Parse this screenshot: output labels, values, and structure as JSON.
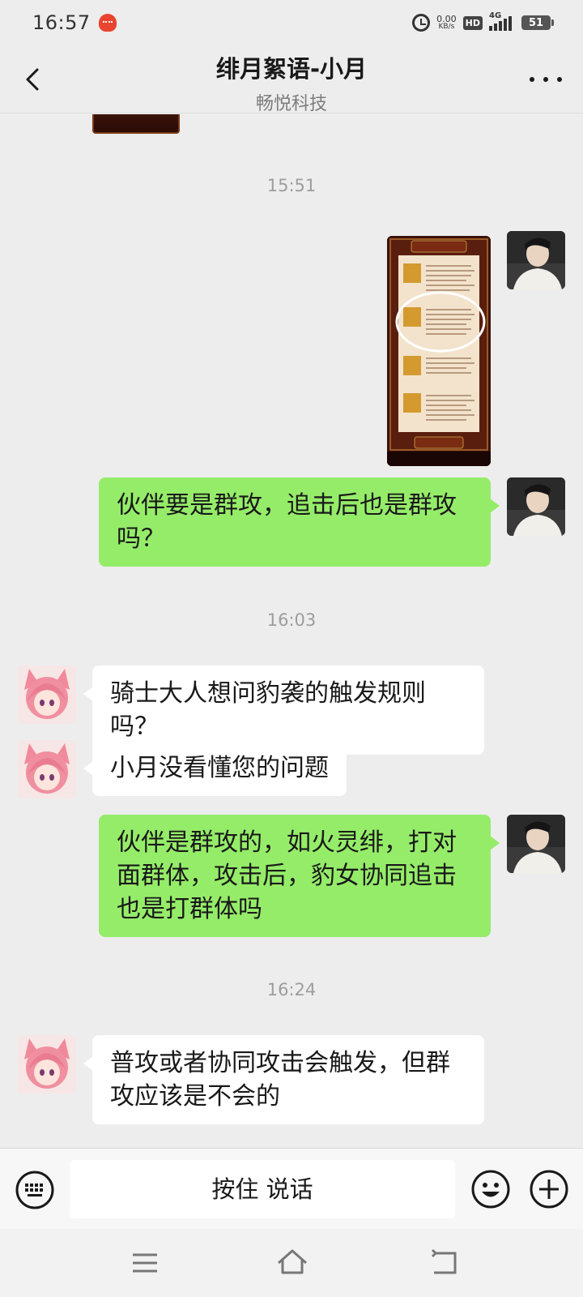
{
  "status_bar": {
    "time": "16:57",
    "net_speed_value": "0.00",
    "net_speed_unit": "KB/s",
    "hd_label": "HD",
    "network_label": "4G",
    "battery": "51"
  },
  "header": {
    "title": "绯月絮语-小月",
    "subtitle": "畅悦科技"
  },
  "chat": {
    "timestamps": [
      "15:51",
      "16:03",
      "16:24"
    ],
    "messages": [
      {
        "sender": "self",
        "type": "image"
      },
      {
        "sender": "self",
        "type": "text",
        "text": "伙伴要是群攻，追击后也是群攻吗？"
      },
      {
        "sender": "bot",
        "type": "text",
        "text": "骑士大人想问豹袭的触发规则吗？"
      },
      {
        "sender": "bot",
        "type": "text",
        "text": "小月没看懂您的问题"
      },
      {
        "sender": "self",
        "type": "text",
        "text": "伙伴是群攻的，如火灵绯，打对面群体，攻击后，豹女协同追击也是打群体吗"
      },
      {
        "sender": "bot",
        "type": "text",
        "text": "普攻或者协同攻击会触发，但群攻应该是不会的"
      }
    ]
  },
  "input_bar": {
    "voice_label": "按住 说话"
  },
  "colors": {
    "self_bubble": "#95ec69",
    "bot_bubble": "#ffffff",
    "background": "#ededed"
  },
  "icons": {
    "back": "chevron-left-icon",
    "more": "more-dots-icon",
    "keyboard": "keyboard-icon",
    "emoji": "emoji-icon",
    "plus": "plus-icon"
  }
}
